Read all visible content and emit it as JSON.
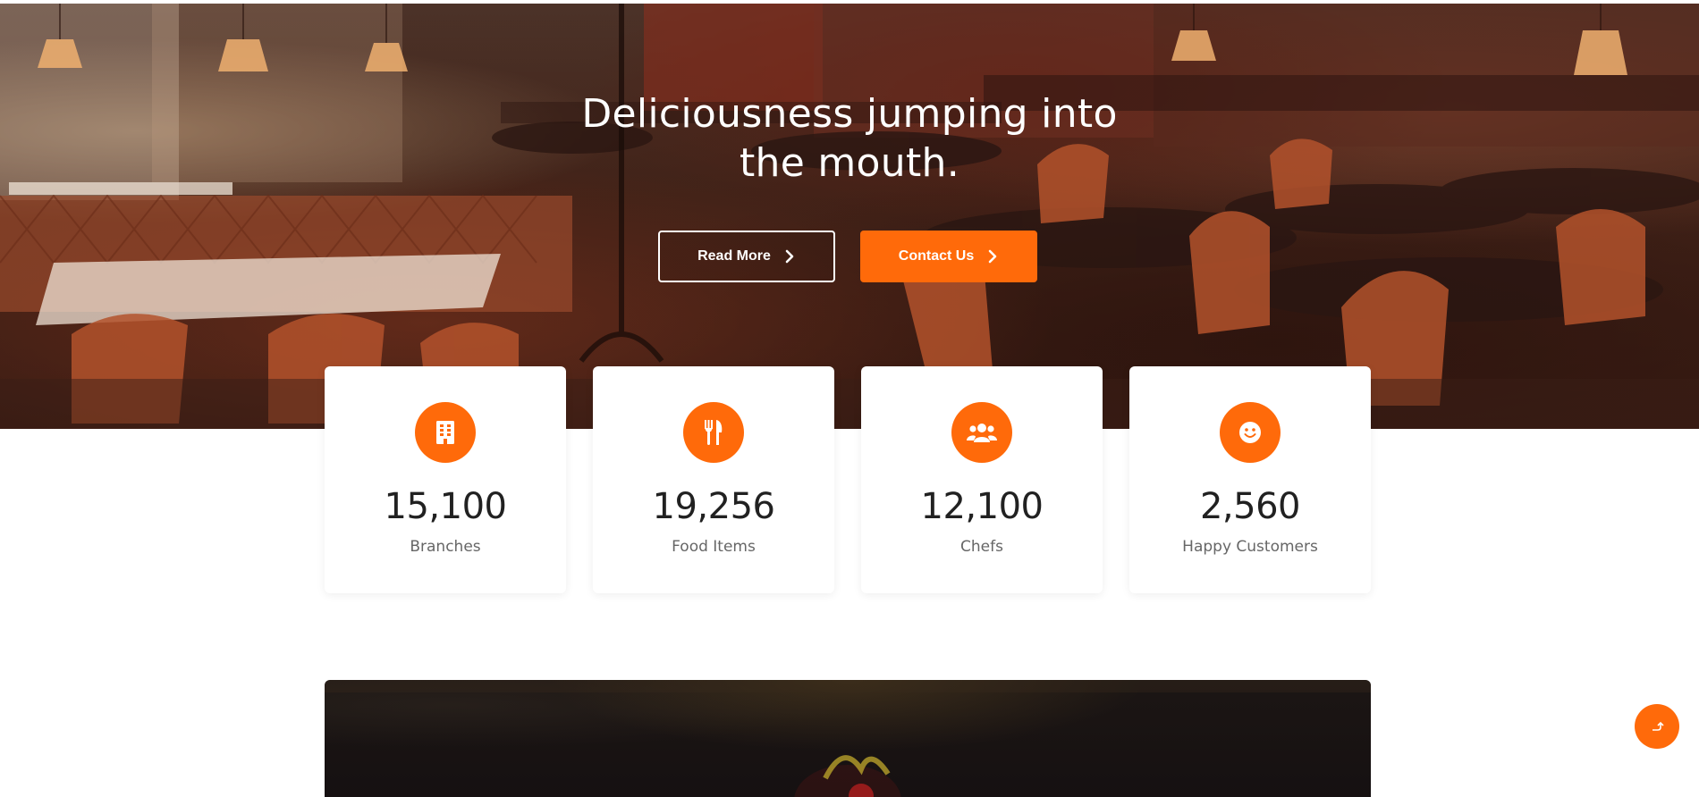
{
  "hero": {
    "title_line1": "Deliciousness jumping into",
    "title_line2": "the mouth.",
    "read_more_label": "Read More",
    "contact_label": "Contact Us"
  },
  "stats": [
    {
      "icon": "building-icon",
      "value": "15,100",
      "label": "Branches"
    },
    {
      "icon": "utensils-icon",
      "value": "19,256",
      "label": "Food Items"
    },
    {
      "icon": "users-icon",
      "value": "12,100",
      "label": "Chefs"
    },
    {
      "icon": "smile-icon",
      "value": "2,560",
      "label": "Happy Customers"
    }
  ],
  "scroll_top": {
    "icon": "arrow-up-icon"
  },
  "colors": {
    "accent": "#ff6a0a",
    "text_dark": "#212121",
    "text_muted": "#666666",
    "hero_overlay": "#3a1c12"
  }
}
